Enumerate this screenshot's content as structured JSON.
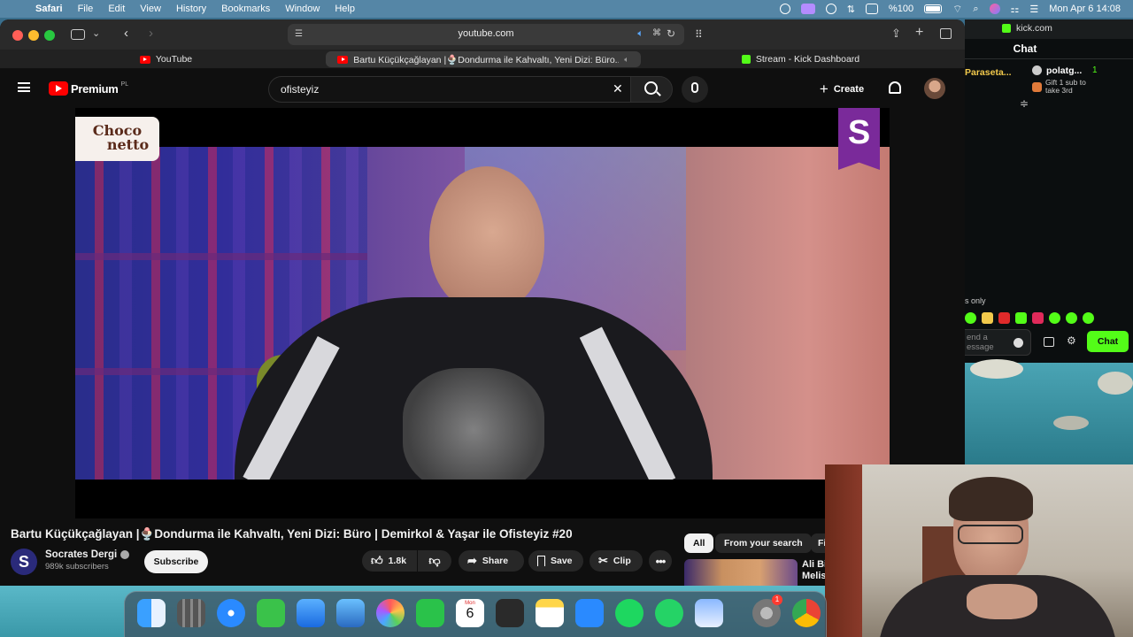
{
  "menubar": {
    "app": "Safari",
    "items": [
      "File",
      "Edit",
      "View",
      "History",
      "Bookmarks",
      "Window",
      "Help"
    ],
    "battery": "%100",
    "clock": "Mon Apr 6  14:08"
  },
  "browser": {
    "url": "youtube.com",
    "tabs": [
      {
        "label": "YouTube"
      },
      {
        "label": "Bartu Küçükçağlayan |🍨Dondurma ile Kahvaltı, Yeni Dizi: Büro..."
      },
      {
        "label": "Stream - Kick Dashboard"
      }
    ]
  },
  "youtube": {
    "logo_text": "Premium",
    "logo_badge": "PL",
    "search_value": "ofisteyiz",
    "create_label": "Create",
    "video": {
      "overlay_brand_top": "Choco",
      "overlay_brand_bottom": "netto",
      "channel_badge_letter": "S"
    },
    "title": "Bartu Küçükçağlayan |🍨Dondurma ile Kahvaltı, Yeni Dizi: Büro | Demirkol & Yaşar ile Ofisteyiz #20",
    "channel": {
      "avatar_letter": "S",
      "name": "Socrates Dergi",
      "subscribers": "989k subscribers",
      "subscribe_label": "Subscribe"
    },
    "actions": {
      "likes": "1.8k",
      "share": "Share",
      "save": "Save",
      "clip": "Clip"
    },
    "chips": [
      "All",
      "From your search",
      "Fi"
    ],
    "suggestion": {
      "title_line1": "Ali Bi",
      "title_line2": "Melis"
    }
  },
  "kick": {
    "url": "kick.com",
    "chat_title": "Chat",
    "user_left": "Paraseta...",
    "gift_user": "polatg...",
    "gift_count": "1",
    "gift_text": "Gift 1 sub to take 3rd",
    "followers_only": "s only",
    "input_placeholder": "end a\nessage",
    "chat_button": "Chat"
  },
  "dock": {
    "calendar_month": "Mon",
    "calendar_day": "6",
    "settings_badge": "1",
    "icons": [
      "finder-icon",
      "launchpad-icon",
      "safari-icon",
      "messages-icon",
      "mail-icon",
      "xcode-icon",
      "photos-icon",
      "facetime-icon",
      "calendar-icon",
      "reminders-icon",
      "notes-icon",
      "appstore-icon",
      "spotify-icon",
      "whatsapp-icon",
      "preview-icon",
      "system-settings-icon",
      "chrome-icon"
    ]
  },
  "colors": {
    "youtube_red": "#ff0000",
    "kick_green": "#53fc18",
    "dark_bg": "#0f0f0f"
  }
}
